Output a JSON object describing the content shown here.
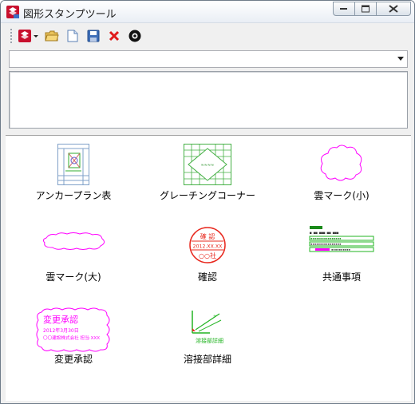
{
  "window": {
    "title": "図形スタンプツール",
    "icon": "stamp-tool-app-icon",
    "buttons": [
      "minimize-icon",
      "maximize-icon",
      "close-icon"
    ]
  },
  "toolbar": {
    "items": [
      "stamp-menu-icon",
      "open-folder-icon",
      "new-file-icon",
      "save-icon",
      "delete-icon",
      "camera-icon"
    ]
  },
  "combo": {
    "value": ""
  },
  "memo": {
    "value": ""
  },
  "stamps": [
    {
      "label": "アンカープラン表",
      "icon": "anchor-plan-table-icon"
    },
    {
      "label": "グレーチングコーナー",
      "icon": "grating-corner-icon"
    },
    {
      "label": "雲マーク(小)",
      "icon": "cloud-mark-small-icon"
    },
    {
      "label": "雲マーク(大)",
      "icon": "cloud-mark-large-icon"
    },
    {
      "label": "確認",
      "icon": "confirm-seal-icon",
      "seal": {
        "top": "確 認",
        "date": "2012.XX.XX",
        "name": "○○社"
      }
    },
    {
      "label": "共通事項",
      "icon": "common-items-icon"
    },
    {
      "label": "変更承認",
      "icon": "change-approval-icon",
      "stamp": {
        "title": "変更承認",
        "date": "2012年3月30日",
        "company": "〇〇建設株式会社 担当:XXX"
      }
    },
    {
      "label": "溶接部詳細",
      "icon": "weld-detail-icon",
      "caption": "溶接部詳細"
    }
  ],
  "colors": {
    "magenta": "#ff00ff",
    "red": "#e8281e",
    "green": "#22b422"
  }
}
